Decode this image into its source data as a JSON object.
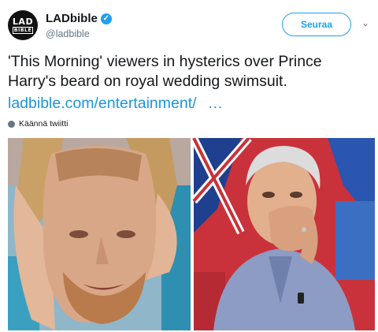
{
  "account": {
    "avatar_line1": "LAD",
    "avatar_line2": "BIBLE",
    "name": "LADbible",
    "verified_glyph": "✓",
    "handle": "@ladbible"
  },
  "actions": {
    "follow_label": "Seuraa",
    "menu_glyph": "⌄"
  },
  "tweet": {
    "text": "'This Morning' viewers in hysterics over Prince Harry's beard on royal wedding swimsuit.",
    "link": "ladbible.com/entertainment/",
    "ellipsis": "…",
    "translate_label": "Käännä twiitti"
  },
  "media": {
    "left_photo_icon": "swimsuit-face-photo",
    "right_photo_icon": "presenter-laughing-photo"
  },
  "colors": {
    "accent": "#1da1f2",
    "link": "#1b95e0",
    "secondary_text": "#657786"
  }
}
